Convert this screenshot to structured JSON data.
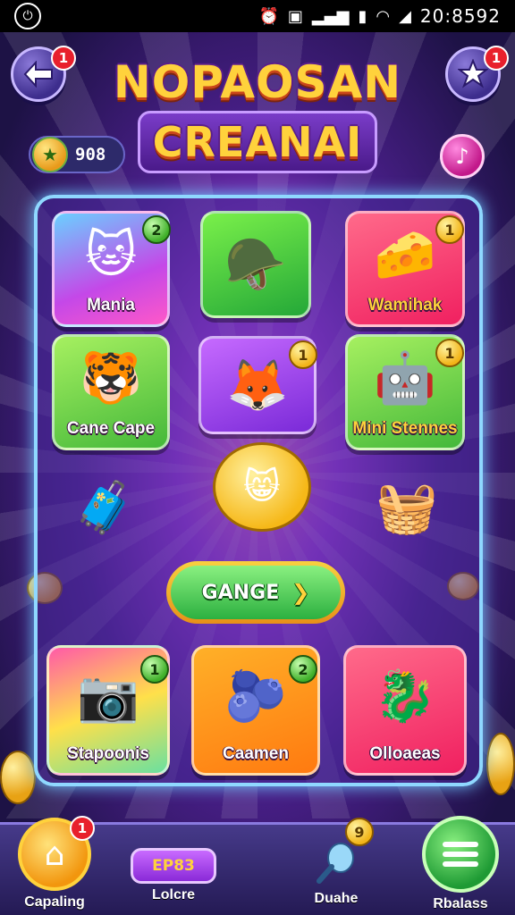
{
  "status_bar": {
    "time": "20:8592",
    "icons": [
      "alarm-icon",
      "sim-icon",
      "vibrate-icon",
      "signal-icon",
      "battery-icon",
      "wifi-icon",
      "signal-strength-icon"
    ]
  },
  "header": {
    "title_line1": "NOPAOSAN",
    "title_line2": "CREANAI",
    "back_badge": "1",
    "star_badge": "1",
    "coins": "908"
  },
  "tiles": [
    {
      "label": "Mania",
      "badge": "2",
      "icon": "pink-cat-icon"
    },
    {
      "label": "",
      "badge": "",
      "icon": "golden-helmet-icon"
    },
    {
      "label": "Wamihak",
      "badge": "1",
      "icon": "gold-bar-icon"
    },
    {
      "label": "Cane Cape",
      "badge": "",
      "icon": "orange-cat-with-box-icon"
    },
    {
      "label": "",
      "badge": "1",
      "icon": "pink-fox-icon"
    },
    {
      "label": "Mini Stennes",
      "badge": "1",
      "icon": "toy-robot-icon"
    },
    {
      "label": "",
      "badge": "",
      "icon": "red-padlock-icon"
    },
    {
      "label": "",
      "badge": "",
      "icon": "candy-basket-icon"
    }
  ],
  "play_button": {
    "label": "GANGE"
  },
  "bottom_tiles": [
    {
      "label": "Stapoonis",
      "badge": "1",
      "icon": "camera-toy-icon"
    },
    {
      "label": "Caamen",
      "badge": "2",
      "icon": "purple-blob-icon"
    },
    {
      "label": "Olloaeas",
      "badge": "",
      "icon": "golden-dragon-icon"
    }
  ],
  "nav": [
    {
      "label": "Capaling",
      "badge": "1",
      "icon": "home-icon"
    },
    {
      "label": "Lolcre",
      "pill": "EP83",
      "icon": "crown-icon"
    },
    {
      "label": "Duahe",
      "badge": "9",
      "icon": "potion-icon"
    },
    {
      "label": "Rbalass",
      "icon": "menu-icon"
    }
  ]
}
